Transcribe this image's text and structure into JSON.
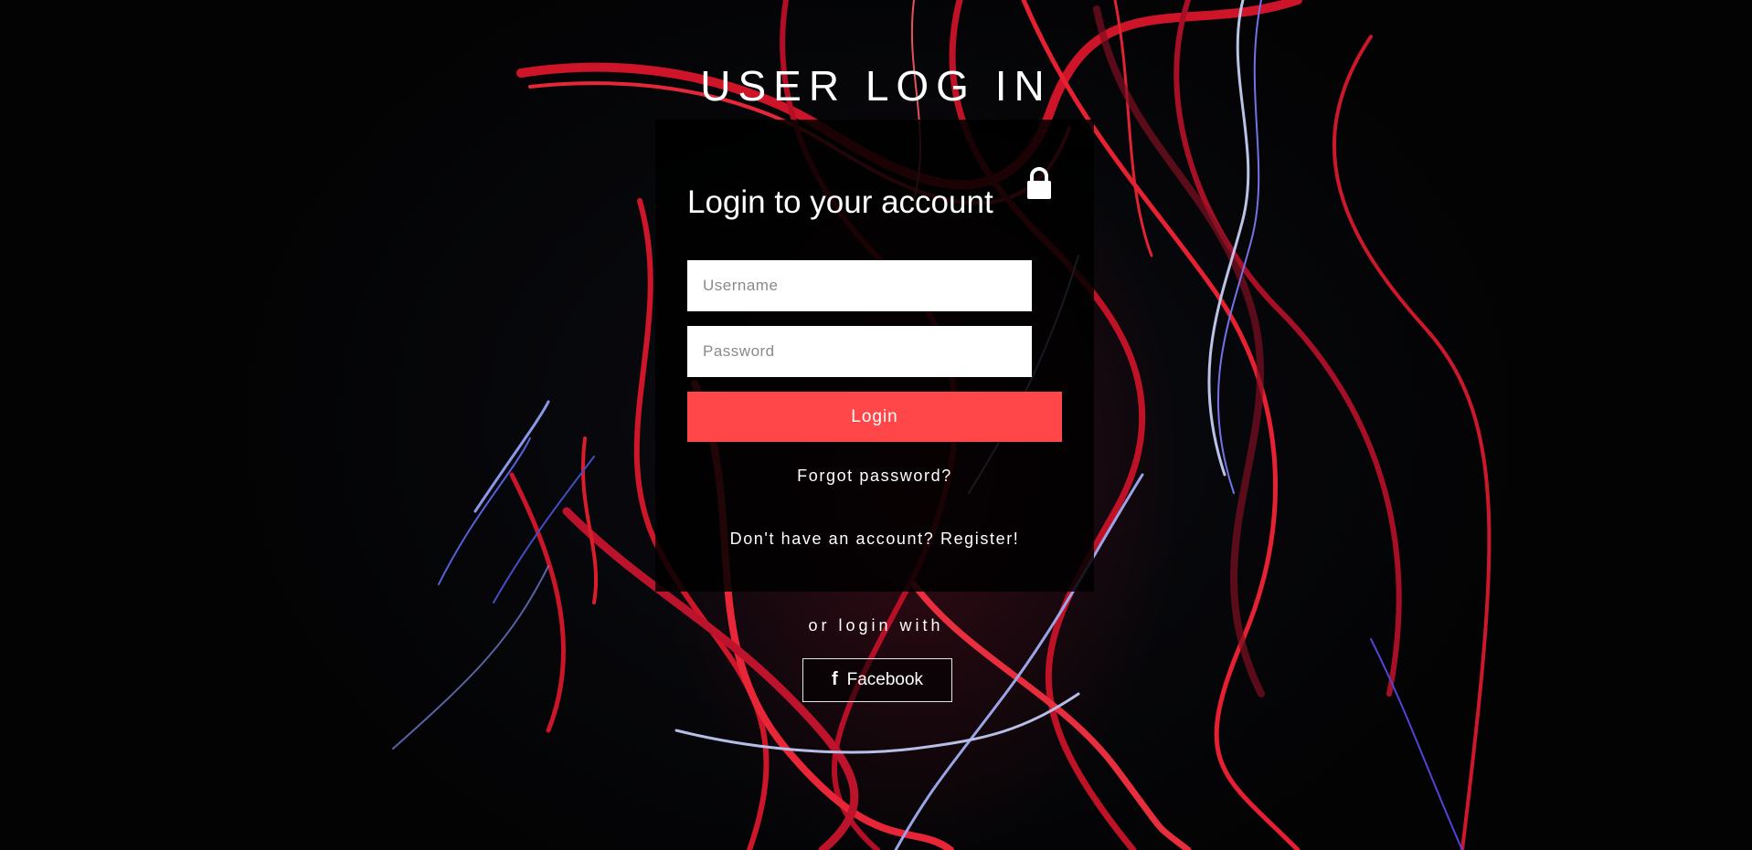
{
  "header": {
    "title": "USER LOG IN"
  },
  "login_card": {
    "heading": "Login to your account",
    "lock_icon": "lock-icon",
    "username_placeholder": "Username",
    "username_value": "",
    "password_placeholder": "Password",
    "password_value": "",
    "login_label": "Login",
    "forgot_label": "Forgot password?",
    "register_label": "Don't have an account? Register!"
  },
  "social": {
    "or_label": "or login with",
    "facebook_label": "Facebook",
    "facebook_icon": "facebook-icon"
  },
  "colors": {
    "accent": "#ff474a",
    "card_background": "#000000",
    "text": "#ffffff"
  }
}
